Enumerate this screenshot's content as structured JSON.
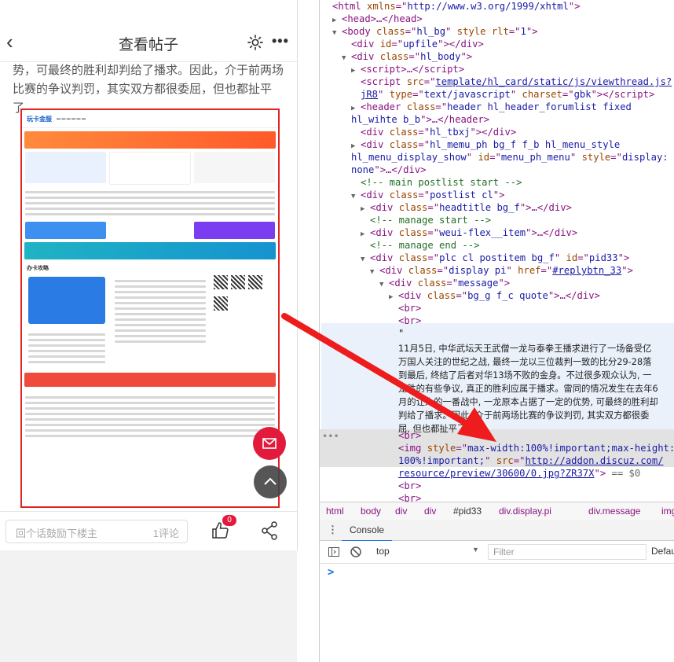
{
  "mobile": {
    "title": "查看帖子",
    "back_icon": "chevron-left-icon",
    "settings_icon": "gear-icon",
    "more_label": "•••",
    "post_text_line1": "势，可最终的胜利却判给了播求。因此，介于前两场",
    "post_text_line2": "比赛的争议判罚，其实双方都很委屈，但也都扯平",
    "post_text_line3": "了。",
    "embedded_image": {
      "site_logo": "玩卡金服",
      "section_label": "办卡攻略"
    },
    "mail_button_icon": "mail-icon",
    "back_to_top_icon": "arrow-up-icon",
    "footer": {
      "reply_placeholder": "回个话鼓励下楼主",
      "reply_count": "1评论",
      "like_badge": "0",
      "like_icon": "thumbs-up-icon",
      "share_icon": "share-icon"
    }
  },
  "devtools": {
    "dom_lines": [
      {
        "indent": 0,
        "tri": "",
        "html": "<span class='tag'>&lt;html</span> <span class='att'>xmlns</span>=\"<span class='val'>http://www.w3.org/1999/xhtml</span>\"<span class='tag'>&gt;</span>"
      },
      {
        "indent": 1,
        "tri": "▶",
        "html": "<span class='tag'>&lt;head&gt;</span>…<span class='tag'>&lt;/head&gt;</span>"
      },
      {
        "indent": 1,
        "tri": "▼",
        "html": "<span class='tag'>&lt;body</span> <span class='att'>class</span>=\"<span class='val'>hl_bg</span>\" <span class='att'>style</span> <span class='att'>rlt</span>=\"<span class='val'>1</span>\"<span class='tag'>&gt;</span>"
      },
      {
        "indent": 2,
        "tri": "",
        "html": "<span class='tag'>&lt;div</span> <span class='att'>id</span>=\"<span class='val'>upfile</span>\"<span class='tag'>&gt;&lt;/div&gt;</span>"
      },
      {
        "indent": 2,
        "tri": "▼",
        "html": "<span class='tag'>&lt;div</span> <span class='att'>class</span>=\"<span class='val'>hl_body</span>\"<span class='tag'>&gt;</span>"
      },
      {
        "indent": 3,
        "tri": "▶",
        "html": "<span class='tag'>&lt;script&gt;</span>…<span class='tag'>&lt;/script&gt;</span>"
      },
      {
        "indent": 3,
        "tri": "",
        "html": "<span class='tag'>&lt;script</span> <span class='att'>src</span>=\"<span class='val' style='text-decoration:underline'>template/hl_card/static/js/viewthread.js?</span>"
      },
      {
        "indent": 3,
        "tri": "",
        "html": "<span class='val' style='text-decoration:underline'>jR8</span>\" <span class='att'>type</span>=\"<span class='val'>text/javascript</span>\" <span class='att'>charset</span>=\"<span class='val'>gbk</span>\"<span class='tag'>&gt;&lt;/script&gt;</span>"
      },
      {
        "indent": 3,
        "tri": "▶",
        "html": "<span class='tag'>&lt;header</span> <span class='att'>class</span>=\"<span class='val'>header hl_header_forumlist fixed</span>"
      },
      {
        "indent": 2,
        "tri": "",
        "html": "<span class='val'>hl_wihte b_b</span>\"<span class='tag'>&gt;</span>…<span class='tag'>&lt;/header&gt;</span>"
      },
      {
        "indent": 3,
        "tri": "",
        "html": "<span class='tag'>&lt;div</span> <span class='att'>class</span>=\"<span class='val'>hl_tbxj</span>\"<span class='tag'>&gt;&lt;/div&gt;</span>"
      },
      {
        "indent": 3,
        "tri": "▶",
        "html": "<span class='tag'>&lt;div</span> <span class='att'>class</span>=\"<span class='val'>hl_memu_ph bg_f f_b hl_menu_style</span>"
      },
      {
        "indent": 2,
        "tri": "",
        "html": "<span class='val'>hl_menu_display_show</span>\" <span class='att'>id</span>=\"<span class='val'>menu_ph_menu</span>\" <span class='att'>style</span>=\"<span class='val'>display:</span>"
      },
      {
        "indent": 2,
        "tri": "",
        "html": "<span class='val'>none</span>\"<span class='tag'>&gt;</span>…<span class='tag'>&lt;/div&gt;</span>"
      },
      {
        "indent": 3,
        "tri": "",
        "html": "<span class='cmt'>&lt;!-- main postlist start --&gt;</span>"
      },
      {
        "indent": 3,
        "tri": "▼",
        "html": "<span class='tag'>&lt;div</span> <span class='att'>class</span>=\"<span class='val'>postlist cl</span>\"<span class='tag'>&gt;</span>"
      },
      {
        "indent": 4,
        "tri": "▶",
        "html": "<span class='tag'>&lt;div</span> <span class='att'>class</span>=\"<span class='val'>headtitle bg_f</span>\"<span class='tag'>&gt;</span>…<span class='tag'>&lt;/div&gt;</span>"
      },
      {
        "indent": 4,
        "tri": "",
        "html": "<span class='cmt'>&lt;!-- manage start --&gt;</span>"
      },
      {
        "indent": 4,
        "tri": "▶",
        "html": "<span class='tag'>&lt;div</span> <span class='att'>class</span>=\"<span class='val'>weui-flex__item</span>\"<span class='tag'>&gt;</span>…<span class='tag'>&lt;/div&gt;</span>"
      },
      {
        "indent": 4,
        "tri": "",
        "html": "<span class='cmt'>&lt;!-- manage end --&gt;</span>"
      },
      {
        "indent": 4,
        "tri": "▼",
        "html": "<span class='tag'>&lt;div</span> <span class='att'>class</span>=\"<span class='val'>plc cl postitem bg_f</span>\" <span class='att'>id</span>=\"<span class='val'>pid33</span>\"<span class='tag'>&gt;</span>"
      },
      {
        "indent": 5,
        "tri": "▼",
        "html": "<span class='tag'>&lt;div</span> <span class='att'>class</span>=\"<span class='val'>display pi</span>\" <span class='att'>href</span>=\"<span class='val' style='text-decoration:underline'>#replybtn_33</span>\"<span class='tag'>&gt;</span>"
      },
      {
        "indent": 6,
        "tri": "▼",
        "html": "<span class='tag'>&lt;div</span> <span class='att'>class</span>=\"<span class='val'>message</span>\"<span class='tag'>&gt;</span>"
      },
      {
        "indent": 7,
        "tri": "▶",
        "html": "<span class='tag'>&lt;div</span> <span class='att'>class</span>=\"<span class='val'>bg_g f_c quote</span>\"<span class='tag'>&gt;</span>…<span class='tag'>&lt;/div&gt;</span>"
      },
      {
        "indent": 7,
        "tri": "",
        "html": "<span class='tag'>&lt;br&gt;</span>"
      },
      {
        "indent": 7,
        "tri": "",
        "html": "<span class='tag'>&lt;br&gt;</span>"
      },
      {
        "indent": 7,
        "tri": "",
        "html": "<span class='txt'>\"</span>"
      }
    ],
    "message_text": [
      "11月5日, 中华武坛天王武僧一龙与泰拳王播求进行了一场备受亿",
      "万国人关注的世纪之战, 最终一龙以三位裁判一致的比分29-28落",
      "到最后, 终结了后者对华13场不败的金身。不过很多观众认为, 一",
      "龙胜的有些争议, 真正的胜利应属于播求。雷同的情况发生在去年6",
      "月的让人的一番战中, 一龙原本占据了一定的优势, 可最终的胜利却",
      "判给了播求。因此, 介于前两场比赛的争议判罚, 其实双方都很委",
      "屈, 但也都扯平了。\""
    ],
    "after_lines": [
      {
        "indent": 7,
        "html": "<span class='tag'>&lt;br&gt;</span>"
      },
      {
        "indent": 7,
        "html": "<span class='tag'>&lt;img</span> <span class='att'>style</span>=\"<span class='val'>max-width:100%!important;max-height:</span>"
      },
      {
        "indent": 7,
        "html": "<span class='val'>100%!important;</span>\" <span class='att'>src</span>=\"<span class='val' style='text-decoration:underline'>http://addon.discuz.com/</span>"
      },
      {
        "indent": 7,
        "html": "<span class='val' style='text-decoration:underline'>resource/preview/30600/0.jpg?ZR37X</span>\"<span class='tag'>&gt;</span> <span style='color:#666'>== $0</span>"
      },
      {
        "indent": 7,
        "html": "<span class='tag'>&lt;br&gt;</span>"
      },
      {
        "indent": 7,
        "html": "<span class='tag'>&lt;br&gt;</span>"
      },
      {
        "indent": 7,
        "html": "<span class='txt'>\"</span>"
      }
    ],
    "breadcrumbs": [
      "html",
      "body",
      "div",
      "div",
      "#pid33",
      "div.display.pi",
      "div.message",
      "img"
    ],
    "console_tab": "Console",
    "context": "top",
    "filter_placeholder": "Filter",
    "levels_label": "Defau",
    "prompt": ">"
  },
  "colors": {
    "accent_red": "#e02424",
    "devtools_tag": "#881280",
    "devtools_attr": "#994500",
    "devtools_val": "#1a1aa6"
  }
}
